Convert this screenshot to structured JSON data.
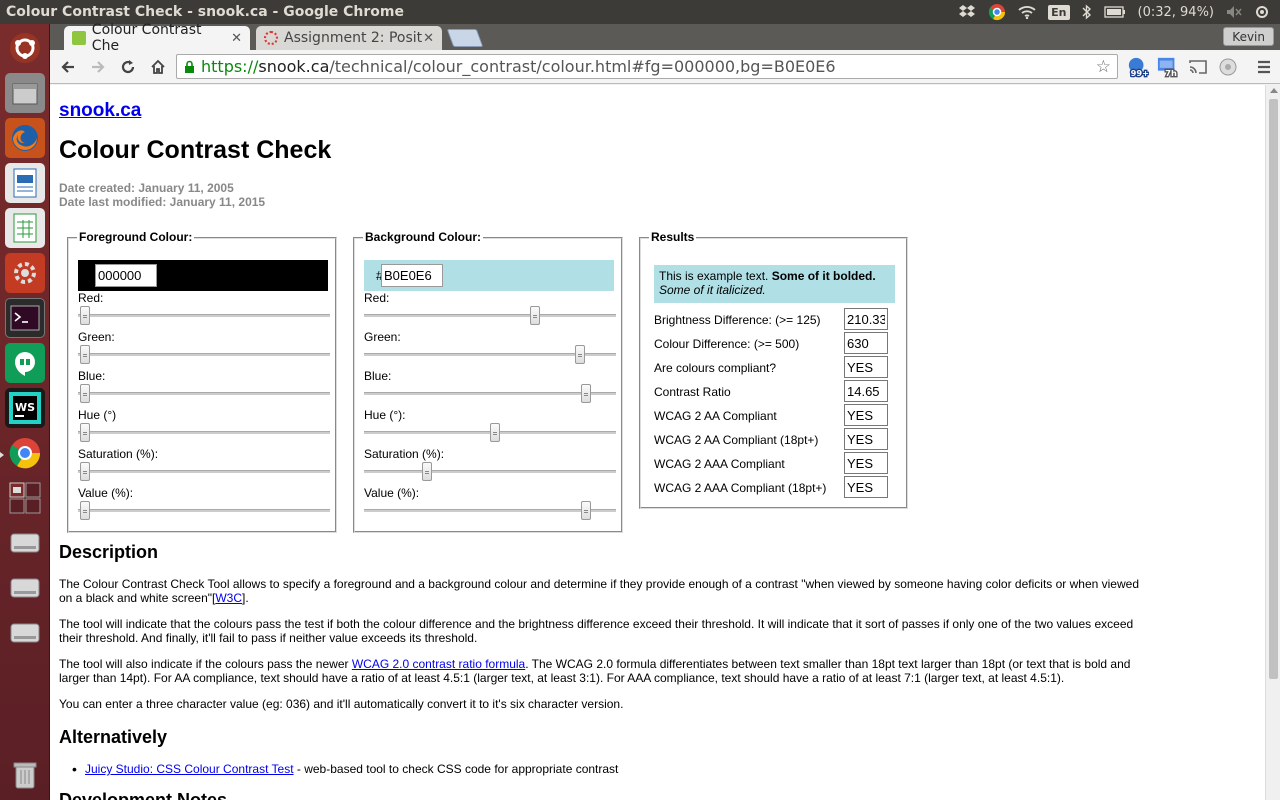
{
  "window": {
    "title": "Colour Contrast Check - snook.ca - Google Chrome"
  },
  "tray": {
    "lang": "En",
    "battery": "(0:32, 94%)"
  },
  "tabs": [
    {
      "label": "Colour Contrast Che"
    },
    {
      "label": "Assignment 2: Posit"
    }
  ],
  "profile": "Kevin",
  "omnibox": {
    "scheme": "https://",
    "host": "snook.ca",
    "path": "/technical/colour_contrast/colour.html#fg=000000,bg=B0E0E6"
  },
  "ext": {
    "badge1": "99+",
    "badge2": "7h"
  },
  "page": {
    "site": "snook.ca",
    "title": "Colour Contrast Check",
    "created": "Date created: January 11, 2005",
    "modified": "Date last modified: January 11, 2015",
    "fg": {
      "legend": "Foreground Colour:",
      "hex": "000000",
      "swatch": "#000000",
      "sliders": [
        {
          "label": "Red:",
          "value": 0
        },
        {
          "label": "Green:",
          "value": 0
        },
        {
          "label": "Blue:",
          "value": 0
        },
        {
          "label": "Hue (°)",
          "value": 0
        },
        {
          "label": "Saturation (%):",
          "value": 0
        },
        {
          "label": "Value (%):",
          "value": 0
        }
      ]
    },
    "bg": {
      "legend": "Background Colour:",
      "hash": "#",
      "hex": "B0E0E6",
      "swatch": "#b0e0e6",
      "sliders": [
        {
          "label": "Red:",
          "value": 0.69
        },
        {
          "label": "Green:",
          "value": 0.878
        },
        {
          "label": "Blue:",
          "value": 0.902
        },
        {
          "label": "Hue (°):",
          "value": 0.519
        },
        {
          "label": "Saturation (%):",
          "value": 0.235
        },
        {
          "label": "Value (%):",
          "value": 0.902
        }
      ]
    },
    "results": {
      "legend": "Results",
      "example_plain": "This is example text. ",
      "example_bold": "Some of it bolded.",
      "example_italic": "Some of it italicized.",
      "rows": [
        {
          "label": "Brightness Difference: (>= 125)",
          "value": "210.33"
        },
        {
          "label": "Colour Difference: (>= 500)",
          "value": "630"
        },
        {
          "label": "Are colours compliant?",
          "value": "YES"
        },
        {
          "label": "Contrast Ratio",
          "value": "14.65"
        },
        {
          "label": "WCAG 2 AA Compliant",
          "value": "YES"
        },
        {
          "label": "WCAG 2 AA Compliant (18pt+)",
          "value": "YES"
        },
        {
          "label": "WCAG 2 AAA Compliant",
          "value": "YES"
        },
        {
          "label": "WCAG 2 AAA Compliant (18pt+)",
          "value": "YES"
        }
      ]
    },
    "description": {
      "heading": "Description",
      "p1a": "The Colour Contrast Check Tool allows to specify a foreground and a background colour and determine if they provide enough of a contrast \"when viewed by someone having color deficits or when viewed on a black and white screen\"[",
      "p1link": "W3C",
      "p1b": "].",
      "p2": "The tool will indicate that the colours pass the test if both the colour difference and the brightness difference exceed their threshold. It will indicate that it sort of passes if only one of the two values exceed their threshold. And finally, it'll fail to pass if neither value exceeds its threshold.",
      "p3a": "The tool will also indicate if the colours pass the newer ",
      "p3link": "WCAG 2.0 contrast ratio formula",
      "p3b": ". The WCAG 2.0 formula differentiates between text smaller than 18pt text larger than 18pt (or text that is bold and larger than 14pt). For AA compliance, text should have a ratio of at least 4.5:1 (larger text, at least 3:1). For AAA compliance, text should have a ratio of at least 7:1 (larger text, at least 4.5:1).",
      "p4": "You can enter a three character value (eg: 036) and it'll automatically convert it to it's six character version."
    },
    "alternatively": {
      "heading": "Alternatively",
      "link": "Juicy Studio: CSS Colour Contrast Test",
      "rest": " - web-based tool to check CSS code for appropriate contrast"
    },
    "devnotes": {
      "heading": "Development Notes"
    }
  }
}
